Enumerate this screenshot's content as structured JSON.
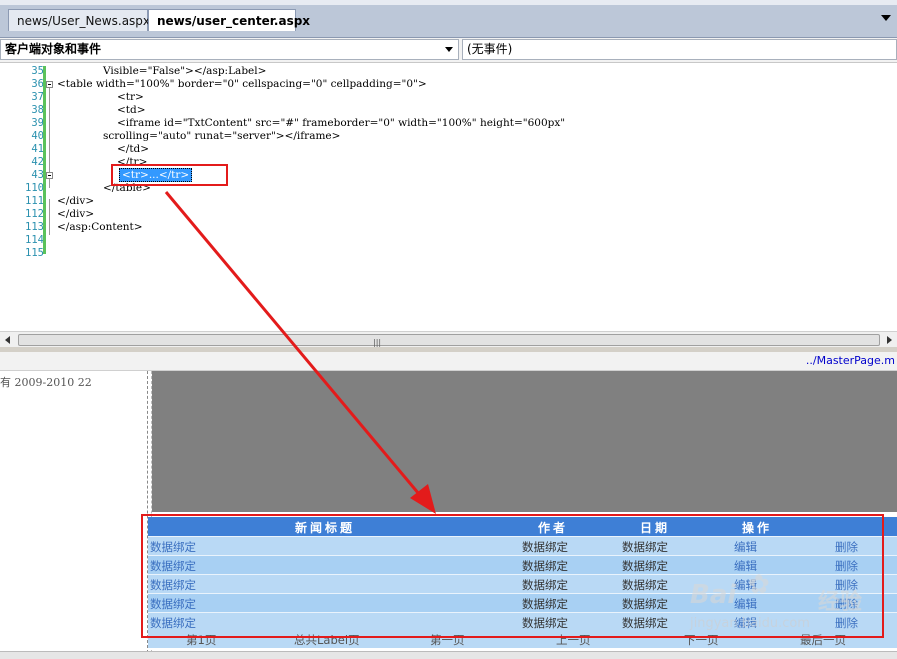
{
  "tabs": [
    {
      "label": "news/User_News.aspx",
      "active": false
    },
    {
      "label": "news/user_center.aspx",
      "active": true
    }
  ],
  "combos": {
    "left": "客户端对象和事件",
    "right": "(无事件)"
  },
  "editor": {
    "line_numbers": [
      "35",
      "36",
      "37",
      "38",
      "39",
      "40",
      "41",
      "42",
      "43",
      "110",
      "111",
      "112",
      "113",
      "114",
      "115"
    ],
    "lines": {
      "l35": "Visible=\"False\"></asp:Label>",
      "l36": "<table width=\"100%\" border=\"0\" cellspacing=\"0\" cellpadding=\"0\">",
      "l37": "<tr>",
      "l38": "<td>",
      "l39": "<iframe id=\"TxtContent\" src=\"#\" frameborder=\"0\" width=\"100%\" height=\"600px\"",
      "l40": "scrolling=\"auto\" runat=\"server\"></iframe>",
      "l41": "</td>",
      "l42": "</tr>",
      "l43": "<tr>...</tr>",
      "l110": "</table>",
      "l111": "</div>",
      "l112": "</div>",
      "l113": "</asp:Content>"
    }
  },
  "scrollbar_grip": "|||",
  "design": {
    "master_link": "../MasterPage.m",
    "left_text": "有 2009-2010 22",
    "grid": {
      "headers": [
        "新闻标题",
        "作者",
        "日期",
        "操作"
      ],
      "rows": [
        [
          "数据绑定",
          "数据绑定",
          "数据绑定",
          "编辑",
          "删除"
        ],
        [
          "数据绑定",
          "数据绑定",
          "数据绑定",
          "编辑",
          "删除"
        ],
        [
          "数据绑定",
          "数据绑定",
          "数据绑定",
          "编辑",
          "删除"
        ],
        [
          "数据绑定",
          "数据绑定",
          "数据绑定",
          "编辑",
          "删除"
        ],
        [
          "数据绑定",
          "数据绑定",
          "数据绑定",
          "编辑",
          "删除"
        ]
      ],
      "pager": [
        "第1页",
        "总共Label页",
        "第一页",
        "上一页",
        "下一页",
        "最后一页"
      ]
    }
  },
  "watermark": {
    "brand": "Bai",
    "brand_zh": "经验",
    "url": "jingyan.baidu.com"
  },
  "colors": {
    "grid_header": "#3e7fd6",
    "grid_row": "#b9d9f5",
    "annotation": "#e31b1b",
    "selection": "#3399ff"
  }
}
